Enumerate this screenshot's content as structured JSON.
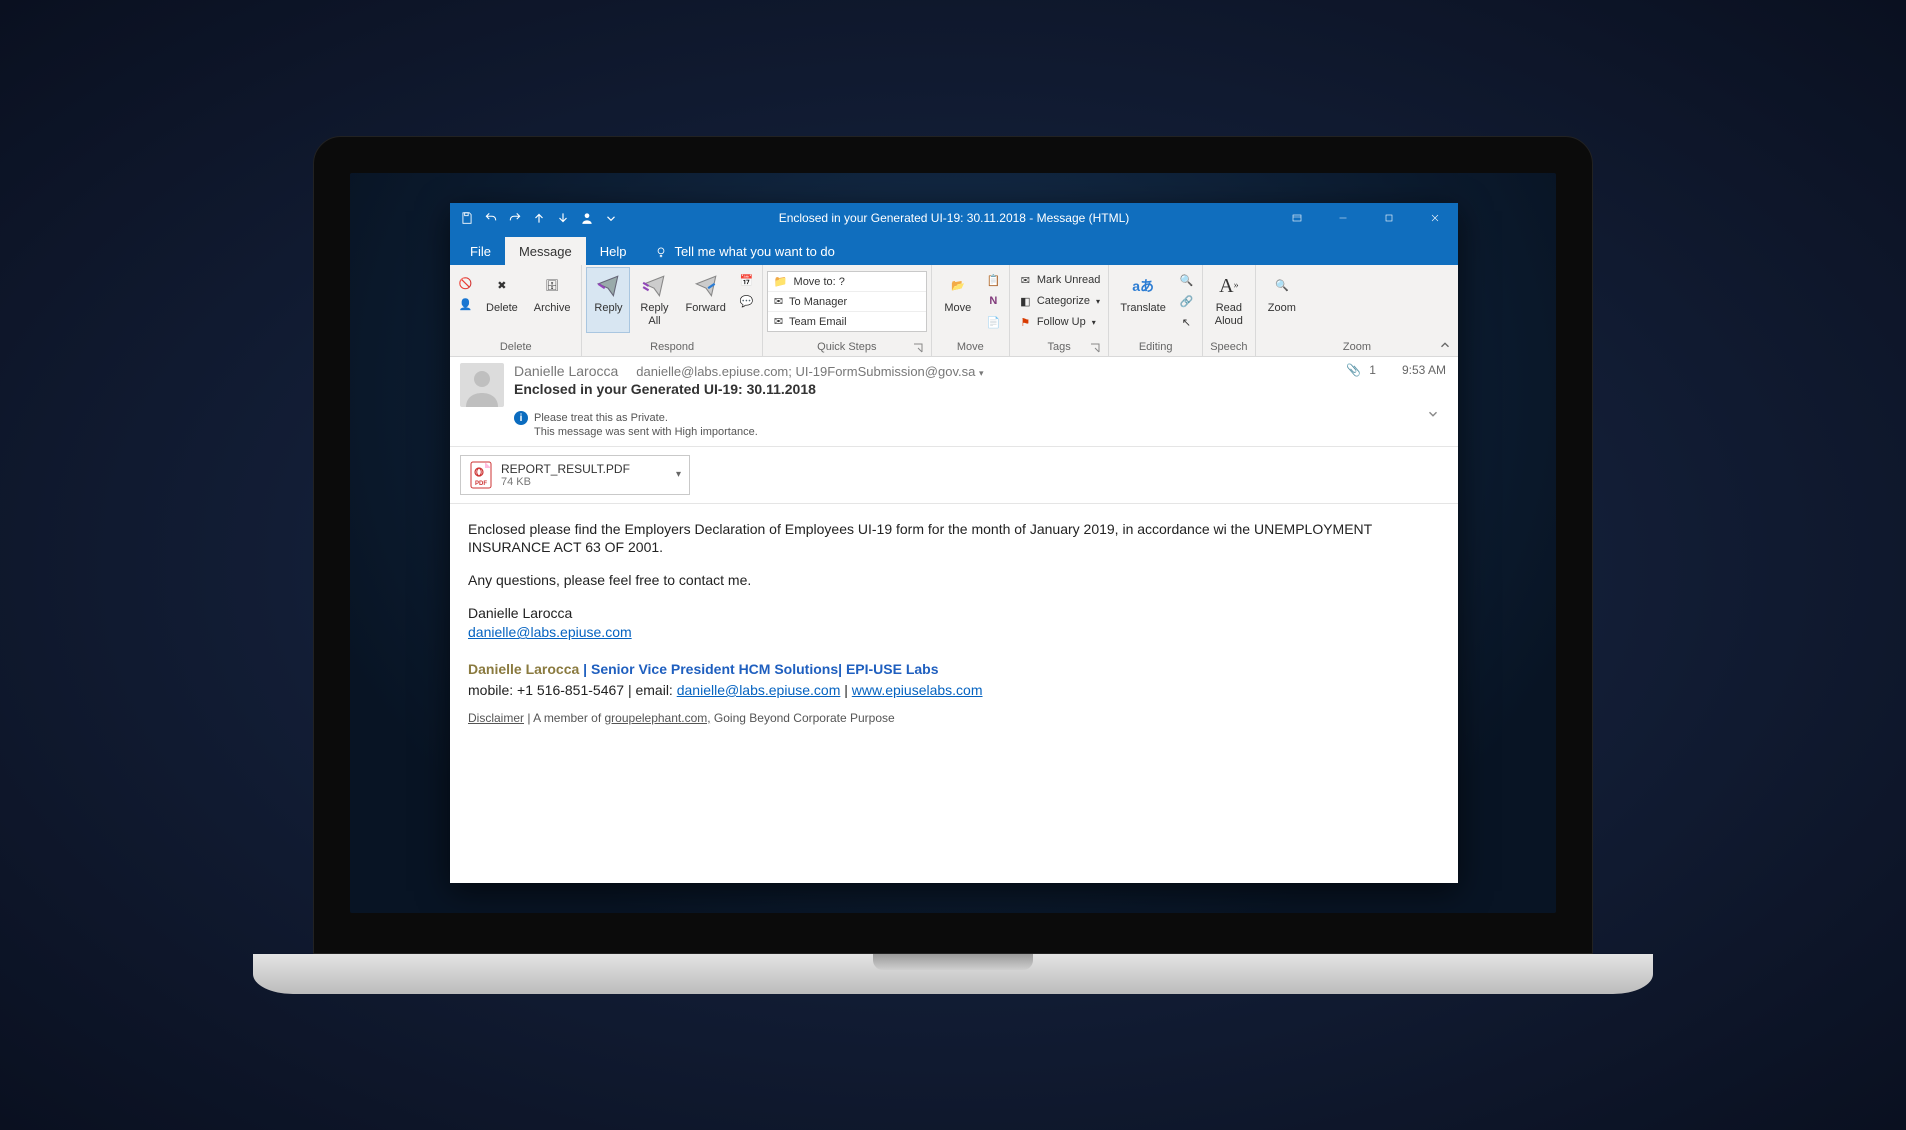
{
  "titlebar": {
    "title": "Enclosed in your Generated UI-19: 30.11.2018  -  Message (HTML)"
  },
  "tabs": {
    "file": "File",
    "message": "Message",
    "help": "Help",
    "tellme": "Tell me what you want to do"
  },
  "ribbon": {
    "delete": {
      "delete": "Delete",
      "archive": "Archive",
      "group": "Delete"
    },
    "respond": {
      "reply": "Reply",
      "replyall": "Reply\nAll",
      "forward": "Forward",
      "group": "Respond"
    },
    "quicksteps": {
      "moveto": "Move to: ?",
      "tomanager": "To Manager",
      "teamemail": "Team Email",
      "group": "Quick Steps"
    },
    "move": {
      "move": "Move",
      "group": "Move"
    },
    "tags": {
      "markunread": "Mark Unread",
      "categorize": "Categorize",
      "followup": "Follow Up",
      "group": "Tags"
    },
    "editing": {
      "translate": "Translate",
      "group": "Editing"
    },
    "speech": {
      "readaloud": "Read\nAloud",
      "group": "Speech"
    },
    "zoom": {
      "zoom": "Zoom",
      "group": "Zoom"
    }
  },
  "message": {
    "from_name": "Danielle Larocca",
    "recipients": "danielle@labs.epiuse.com; UI-19FormSubmission@gov.sa",
    "subject": "Enclosed in your Generated UI-19: 30.11.2018",
    "attachment_count": "1",
    "time": "9:53 AM",
    "privacy_line": "Please treat this as Private.",
    "importance_line": "This message was sent with High importance.",
    "attachment": {
      "name": "REPORT_RESULT.PDF",
      "size": "74 KB"
    },
    "body_p1": "Enclosed please find the Employers Declaration of Employees UI-19 form for the month of January 2019, in accordance wi the UNEMPLOYMENT INSURANCE ACT 63 OF 2001.",
    "body_p2": "Any questions, please feel free to contact me.",
    "sig_name": "Danielle Larocca",
    "sig_email": "danielle@labs.epiuse.com",
    "sig2_name": "Danielle Larocca",
    "sig2_sep": " | ",
    "sig2_title": "Senior Vice President HCM Solutions",
    "sig2_sep2": "| ",
    "sig2_company": "EPI-USE Labs",
    "sig3_mobile": "mobile: +1 516-851-5467 | email: ",
    "sig3_email": "danielle@labs.epiuse.com",
    "sig3_sep": "  |  ",
    "sig3_site": " www.epiuselabs.com ",
    "disclaimer_label": "Disclaimer",
    "disclaimer_sep": " | A member of ",
    "disclaimer_link": "groupelephant.com,",
    "disclaimer_tail": " Going Beyond Corporate Purpose"
  }
}
